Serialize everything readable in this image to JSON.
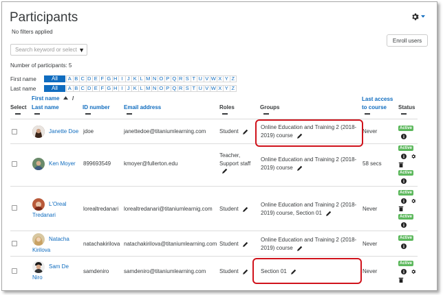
{
  "page": {
    "title": "Participants",
    "filters_text": "No filters applied",
    "enroll_button": "Enroll users",
    "search_placeholder": "Search keyword or select",
    "num_participants": "Number of participants: 5"
  },
  "alpha": {
    "first_label": "First name",
    "last_label": "Last name",
    "all": "All",
    "letters": [
      "A",
      "B",
      "C",
      "D",
      "E",
      "F",
      "G",
      "H",
      "I",
      "J",
      "K",
      "L",
      "M",
      "N",
      "O",
      "P",
      "Q",
      "R",
      "S",
      "T",
      "U",
      "V",
      "W",
      "X",
      "Y",
      "Z"
    ]
  },
  "table": {
    "headers": {
      "select": "Select",
      "first_name": "First name",
      "slash": "/",
      "last_name": "Last name",
      "id_number": "ID number",
      "email": "Email address",
      "roles": "Roles",
      "groups": "Groups",
      "last_access": "Last access to course",
      "status": "Status"
    },
    "active_label": "Active",
    "rows": [
      {
        "name": "Janette Doe",
        "name2": "",
        "id": "jdoe",
        "email": "janettedoe@titaniumlearning.com",
        "role": "Student",
        "role2": "",
        "group": "Online Education and Training 2 (2018-",
        "group2": "2019) course",
        "access": "Never"
      },
      {
        "name": "Ken Moyer",
        "name2": "",
        "id": "899693549",
        "email": "kmoyer@fullerton.edu",
        "role": "Teacher,",
        "role2": "Support staff",
        "group": "Online Education and Training 2 (2018-",
        "group2": "2019) course",
        "access": "58 secs"
      },
      {
        "name": "L'Oreal",
        "name2": "Tredanari",
        "id": "lorealtredanari",
        "email": "lorealtredanari@titaniumlearnig.com",
        "role": "Student",
        "role2": "",
        "group": "Online Education and Training 2 (2018-",
        "group2": "2019) course, Section 01",
        "access": "Never"
      },
      {
        "name": "Natacha",
        "name2": "Kirilova",
        "id": "natachakirilova",
        "email": "natachakirilova@titaniumlearning.com",
        "role": "Student",
        "role2": "",
        "group": "Online Education and Training 2 (2018-",
        "group2": "2019) course",
        "access": "Never"
      },
      {
        "name": "Sam De",
        "name2": "Niro",
        "id": "samdeniro",
        "email": "samdeniro@titaniumlearning.com",
        "role": "Student",
        "role2": "",
        "group": "Section 01",
        "group2": "",
        "access": "Never"
      }
    ]
  },
  "colors": {
    "link": "#0f6cbf",
    "active_badge": "#5cb85c",
    "highlight": "#d0121b"
  }
}
